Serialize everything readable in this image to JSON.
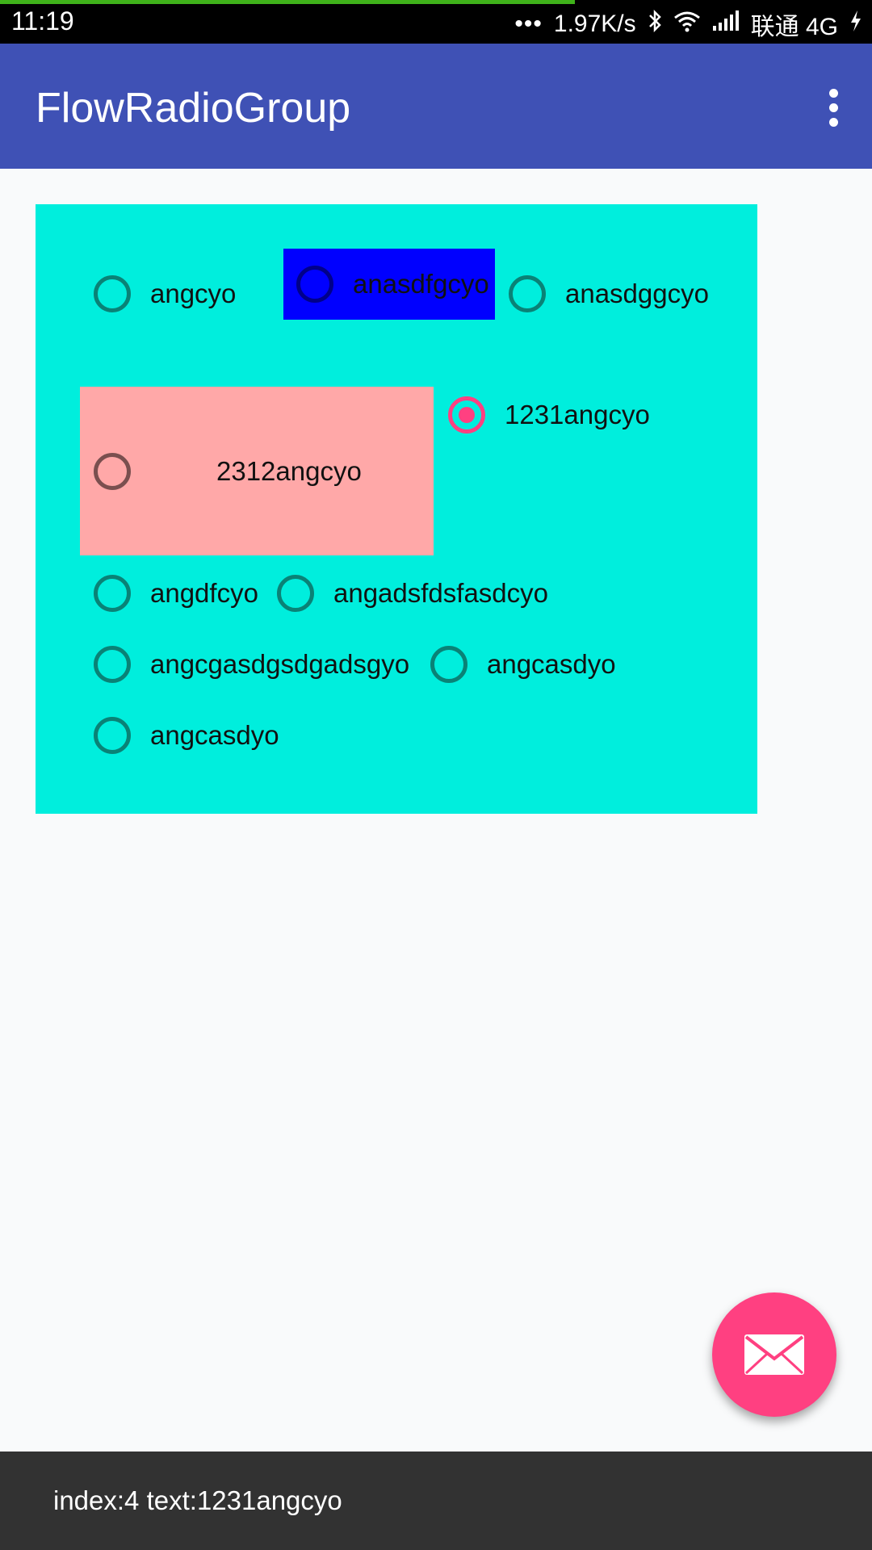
{
  "status_bar": {
    "time": "11:19",
    "dots": "•••",
    "speed": "1.97K/s",
    "carrier": "联通 4G",
    "icons": [
      "bluetooth-icon",
      "wifi-icon",
      "signal-icon",
      "charging-icon"
    ]
  },
  "app_bar": {
    "title": "FlowRadioGroup",
    "overflow_icon": "more-vert-icon",
    "color": "#3f51b5"
  },
  "radio_group": {
    "background": "#00eedd",
    "accent": "#ff4081",
    "items": [
      {
        "label": "angcyo",
        "checked": false
      },
      {
        "label": "anasdfgcyo",
        "checked": false,
        "background": "#0000ff"
      },
      {
        "label": "anasdggcyo",
        "checked": false
      },
      {
        "label": "2312angcyo",
        "checked": false,
        "background": "#ffa8a8"
      },
      {
        "label": "1231angcyo",
        "checked": true
      },
      {
        "label": "angdfcyo",
        "checked": false
      },
      {
        "label": "angadsfdsfasdcyo",
        "checked": false
      },
      {
        "label": "angcgasdgsdgadsgyo",
        "checked": false
      },
      {
        "label": "angcasdyo",
        "checked": false
      },
      {
        "label": "angcasdyo",
        "checked": false
      }
    ]
  },
  "fab": {
    "icon": "mail-icon",
    "color": "#ff4081"
  },
  "snackbar": {
    "text": "index:4 text:1231angcyo"
  }
}
